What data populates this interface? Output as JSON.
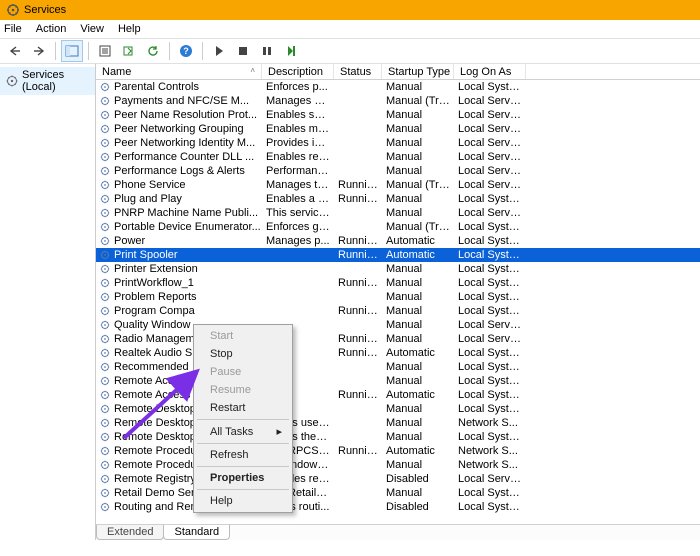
{
  "window": {
    "title": "Services"
  },
  "menus": {
    "file": "File",
    "action": "Action",
    "view": "View",
    "help": "Help"
  },
  "tree": {
    "root": "Services (Local)"
  },
  "columns": {
    "name": "Name",
    "description": "Description",
    "status": "Status",
    "startup": "Startup Type",
    "logon": "Log On As"
  },
  "tabs": {
    "extended": "Extended",
    "standard": "Standard"
  },
  "context_menu": {
    "start": "Start",
    "stop": "Stop",
    "pause": "Pause",
    "resume": "Resume",
    "restart": "Restart",
    "alltasks": "All Tasks",
    "refresh": "Refresh",
    "properties": "Properties",
    "help": "Help"
  },
  "selected_index": 10,
  "services": [
    {
      "name": "Parental Controls",
      "desc": "Enforces p...",
      "status": "",
      "startup": "Manual",
      "logon": "Local Syste..."
    },
    {
      "name": "Payments and NFC/SE M...",
      "desc": "Manages pa...",
      "status": "",
      "startup": "Manual (Trig...",
      "logon": "Local Service"
    },
    {
      "name": "Peer Name Resolution Prot...",
      "desc": "Enables serv...",
      "status": "",
      "startup": "Manual",
      "logon": "Local Service"
    },
    {
      "name": "Peer Networking Grouping",
      "desc": "Enables mul...",
      "status": "",
      "startup": "Manual",
      "logon": "Local Service"
    },
    {
      "name": "Peer Networking Identity M...",
      "desc": "Provides ide...",
      "status": "",
      "startup": "Manual",
      "logon": "Local Service"
    },
    {
      "name": "Performance Counter DLL ...",
      "desc": "Enables rem...",
      "status": "",
      "startup": "Manual",
      "logon": "Local Service"
    },
    {
      "name": "Performance Logs & Alerts",
      "desc": "Performanc...",
      "status": "",
      "startup": "Manual",
      "logon": "Local Service"
    },
    {
      "name": "Phone Service",
      "desc": "Manages th...",
      "status": "Running",
      "startup": "Manual (Trig...",
      "logon": "Local Service"
    },
    {
      "name": "Plug and Play",
      "desc": "Enables a c...",
      "status": "Running",
      "startup": "Manual",
      "logon": "Local Syste..."
    },
    {
      "name": "PNRP Machine Name Publi...",
      "desc": "This service ...",
      "status": "",
      "startup": "Manual",
      "logon": "Local Service"
    },
    {
      "name": "Portable Device Enumerator...",
      "desc": "Enforces gr...",
      "status": "",
      "startup": "Manual (Trig...",
      "logon": "Local Syste..."
    },
    {
      "name": "Power",
      "desc": "Manages p...",
      "status": "Running",
      "startup": "Automatic",
      "logon": "Local Syste..."
    },
    {
      "name": "Print Spooler",
      "desc": "",
      "status": "Running",
      "startup": "Automatic",
      "logon": "Local Syste..."
    },
    {
      "name": "Printer Extension",
      "desc": "",
      "status": "",
      "startup": "Manual",
      "logon": "Local Syste..."
    },
    {
      "name": "PrintWorkflow_1",
      "desc": "",
      "status": "Running",
      "startup": "Manual",
      "logon": "Local Syste..."
    },
    {
      "name": "Problem Reports",
      "desc": "",
      "status": "",
      "startup": "Manual",
      "logon": "Local Syste..."
    },
    {
      "name": "Program Compa",
      "desc": "",
      "status": "Running",
      "startup": "Manual",
      "logon": "Local Syste..."
    },
    {
      "name": "Quality Window",
      "desc": "",
      "status": "",
      "startup": "Manual",
      "logon": "Local Service"
    },
    {
      "name": "Radio Managem",
      "desc": "",
      "status": "Running",
      "startup": "Manual",
      "logon": "Local Service"
    },
    {
      "name": "Realtek Audio S",
      "desc": "",
      "status": "Running",
      "startup": "Automatic",
      "logon": "Local Syste..."
    },
    {
      "name": "Recommended",
      "desc": "",
      "status": "",
      "startup": "Manual",
      "logon": "Local Syste..."
    },
    {
      "name": "Remote Access A",
      "desc": "",
      "status": "",
      "startup": "Manual",
      "logon": "Local Syste..."
    },
    {
      "name": "Remote Access C",
      "desc": "",
      "status": "Running",
      "startup": "Automatic",
      "logon": "Local Syste..."
    },
    {
      "name": "Remote Desktop",
      "desc": "",
      "status": "",
      "startup": "Manual",
      "logon": "Local Syste..."
    },
    {
      "name": "Remote Desktop Services",
      "desc": "Allows user...",
      "status": "",
      "startup": "Manual",
      "logon": "Network S..."
    },
    {
      "name": "Remote Desktop Services U...",
      "desc": "Allows the r...",
      "status": "",
      "startup": "Manual",
      "logon": "Local Syste..."
    },
    {
      "name": "Remote Procedure Call (RPC)",
      "desc": "The RPCSS s...",
      "status": "Running",
      "startup": "Automatic",
      "logon": "Network S..."
    },
    {
      "name": "Remote Procedure Call (RP...",
      "desc": "In Windows...",
      "status": "",
      "startup": "Manual",
      "logon": "Network S..."
    },
    {
      "name": "Remote Registry",
      "desc": "Enables rem...",
      "status": "",
      "startup": "Disabled",
      "logon": "Local Service"
    },
    {
      "name": "Retail Demo Service",
      "desc": "The Retail D...",
      "status": "",
      "startup": "Manual",
      "logon": "Local Syste..."
    },
    {
      "name": "Routing and Remote Access",
      "desc": "Offers routi...",
      "status": "",
      "startup": "Disabled",
      "logon": "Local Syste..."
    }
  ]
}
